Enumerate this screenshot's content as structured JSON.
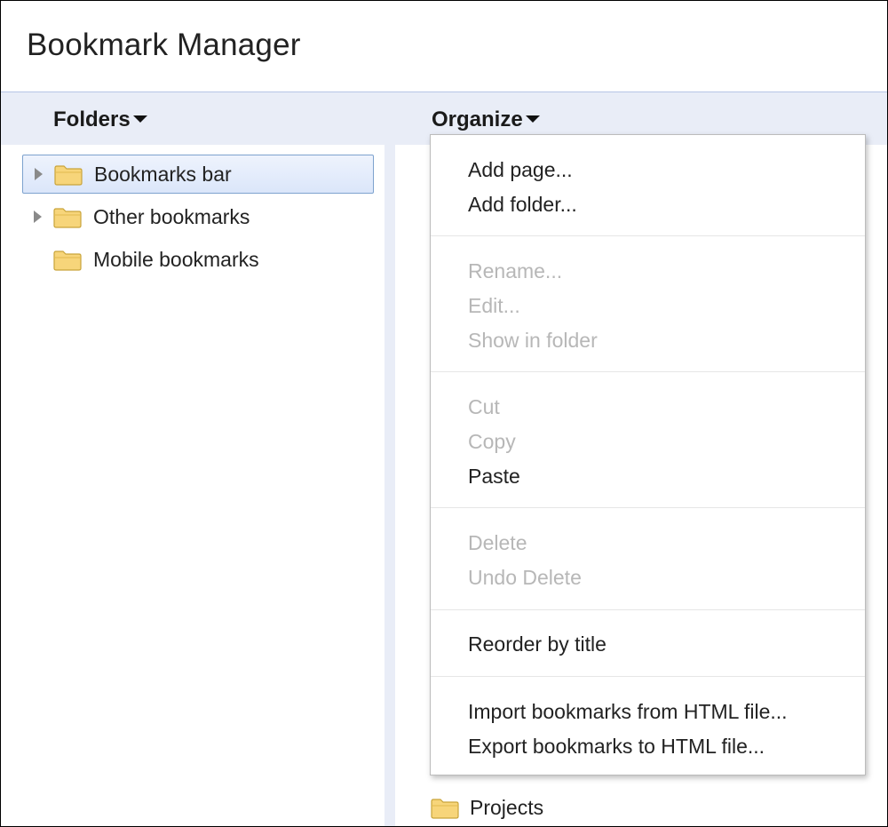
{
  "window": {
    "title": "Bookmark Manager"
  },
  "toolbar": {
    "folders_label": "Folders",
    "organize_label": "Organize"
  },
  "folder_tree": {
    "items": [
      {
        "label": "Bookmarks bar",
        "selected": true,
        "expandable": true,
        "icon": "folder-icon"
      },
      {
        "label": "Other bookmarks",
        "selected": false,
        "expandable": true,
        "icon": "folder-icon"
      },
      {
        "label": "Mobile bookmarks",
        "selected": false,
        "expandable": false,
        "icon": "folder-icon"
      }
    ]
  },
  "organize_menu": {
    "groups": [
      [
        {
          "label": "Add page...",
          "enabled": true
        },
        {
          "label": "Add folder...",
          "enabled": true
        }
      ],
      [
        {
          "label": "Rename...",
          "enabled": false
        },
        {
          "label": "Edit...",
          "enabled": false
        },
        {
          "label": "Show in folder",
          "enabled": false
        }
      ],
      [
        {
          "label": "Cut",
          "enabled": false
        },
        {
          "label": "Copy",
          "enabled": false
        },
        {
          "label": "Paste",
          "enabled": true
        }
      ],
      [
        {
          "label": "Delete",
          "enabled": false
        },
        {
          "label": "Undo Delete",
          "enabled": false
        }
      ],
      [
        {
          "label": "Reorder by title",
          "enabled": true
        }
      ],
      [
        {
          "label": "Import bookmarks from HTML file...",
          "enabled": true
        },
        {
          "label": "Export bookmarks to HTML file...",
          "enabled": true
        }
      ]
    ]
  },
  "bookmark_list": {
    "items": [
      {
        "label": "Projects",
        "icon": "folder-icon"
      }
    ]
  },
  "colors": {
    "toolbar_bg": "#e9edf7",
    "selection_border": "#7da2ce",
    "disabled_text": "#b7b7b7",
    "folder_fill": "#f7d57a"
  }
}
